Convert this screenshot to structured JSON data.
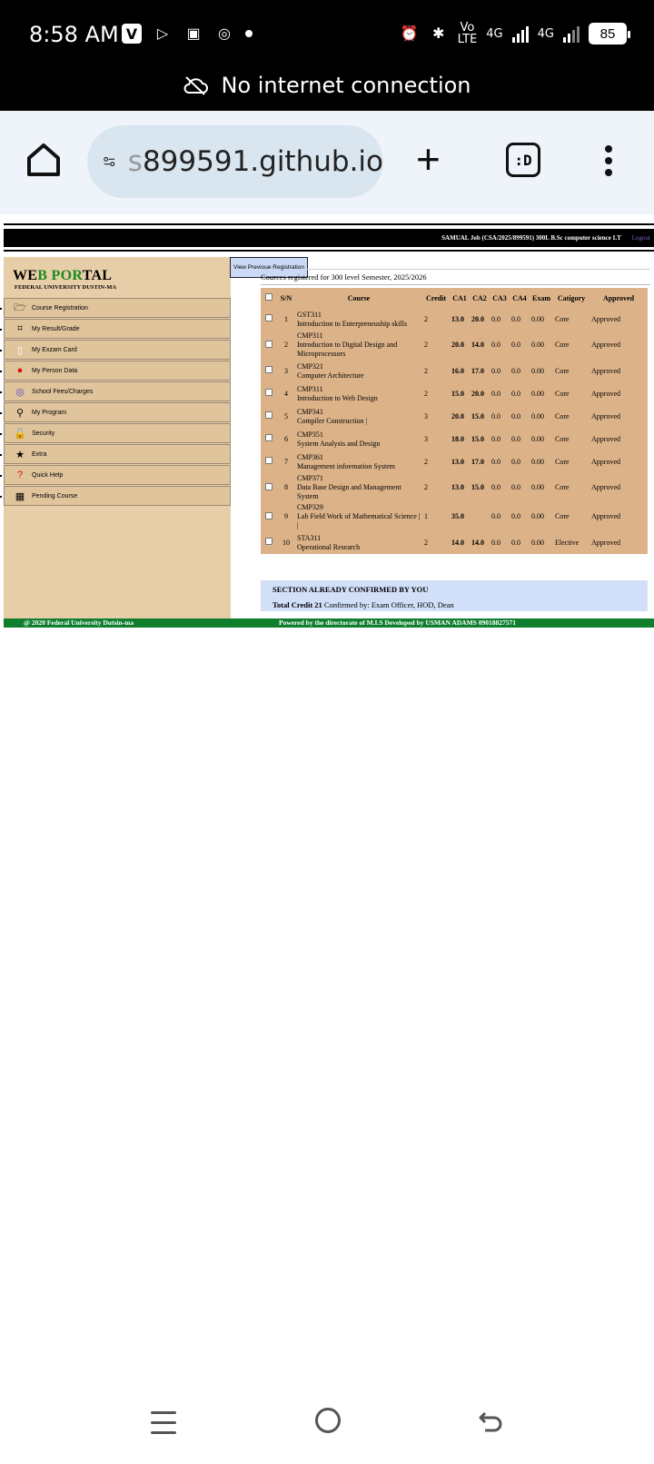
{
  "status_bar": {
    "time": "8:58 AM",
    "network_left": "Vo\nLTE",
    "net1": "4G",
    "net2": "4G",
    "battery": "85",
    "no_internet": "No internet connection"
  },
  "browser": {
    "url_fade": "s",
    "url": "899591.github.io",
    "tabs_label": ":D"
  },
  "header": {
    "user_info": "SAMUAL Job   (CSA/2025/899591)    300L B.Sc computer science I.T",
    "logout": "Logout"
  },
  "brand": {
    "part1": "WE",
    "part2": "B POR",
    "part3": "TAL",
    "subtitle": "FEDERAL UNIVERSITY DUSTIN-MA"
  },
  "menu": [
    {
      "label": "Course Registration",
      "icon": "folder-open-icon"
    },
    {
      "label": "My Result/Grade",
      "icon": "grid-icon"
    },
    {
      "label": "My Exzam Card",
      "icon": "file-icon"
    },
    {
      "label": "My Person Data",
      "icon": "user-icon"
    },
    {
      "label": "School Fees/Charges",
      "icon": "coins-icon"
    },
    {
      "label": "My Program",
      "icon": "search-icon"
    },
    {
      "label": "Security",
      "icon": "unlock-icon"
    },
    {
      "label": "Extra",
      "icon": "star-icon"
    },
    {
      "label": "Quick Help",
      "icon": "question-icon"
    },
    {
      "label": "Pending Course",
      "icon": "calendar-icon"
    }
  ],
  "view_previous_button": "View Previoue Registration",
  "courses_title": "Cources registered for 300 level Semester, 2025/2026",
  "table": {
    "headers": [
      "S/N",
      "Course",
      "Credit",
      "CA1",
      "CA2",
      "CA3",
      "CA4",
      "Exam",
      "Catigory",
      "Approved"
    ],
    "rows": [
      {
        "sn": "1",
        "code": "GST311",
        "title": "Introduction to Enterpreneuship skills",
        "credit": "2",
        "ca1": "13.0",
        "ca2": "20.0",
        "ca3": "0.0",
        "ca4": "0.0",
        "exam": "0.00",
        "category": "Core",
        "approved": "Approved"
      },
      {
        "sn": "2",
        "code": "CMP311",
        "title": "Introduction to Digital Design and Microprocessors",
        "credit": "2",
        "ca1": "20.0",
        "ca2": "14.0",
        "ca3": "0.0",
        "ca4": "0.0",
        "exam": "0.00",
        "category": "Core",
        "approved": "Approved"
      },
      {
        "sn": "3",
        "code": "CMP321",
        "title": "Computer Architecture",
        "credit": "2",
        "ca1": "16.0",
        "ca2": "17.0",
        "ca3": "0.0",
        "ca4": "0.0",
        "exam": "0.00",
        "category": "Core",
        "approved": "Approved"
      },
      {
        "sn": "4",
        "code": "CMP311",
        "title": "Introduction to Web Design",
        "credit": "2",
        "ca1": "15.0",
        "ca2": "20.0",
        "ca3": "0.0",
        "ca4": "0.0",
        "exam": "0.00",
        "category": "Core",
        "approved": "Approved"
      },
      {
        "sn": "5",
        "code": "CMP341",
        "title": "Compiler Construction  |",
        "credit": "3",
        "ca1": "20.0",
        "ca2": "15.0",
        "ca3": "0.0",
        "ca4": "0.0",
        "exam": "0.00",
        "category": "Core",
        "approved": "Approved"
      },
      {
        "sn": "6",
        "code": "CMP351",
        "title": "System Analysis and Design",
        "credit": "3",
        "ca1": "18.0",
        "ca2": "15.0",
        "ca3": "0.0",
        "ca4": "0.0",
        "exam": "0.00",
        "category": "Core",
        "approved": "Approved"
      },
      {
        "sn": "7",
        "code": "CMP361",
        "title": "Management infoemation System",
        "credit": "2",
        "ca1": "13.0",
        "ca2": "17.0",
        "ca3": "0.0",
        "ca4": "0.0",
        "exam": "0.00",
        "category": "Core",
        "approved": "Approved"
      },
      {
        "sn": "8",
        "code": "CMP371",
        "title": "Data Base Design and Management System",
        "credit": "2",
        "ca1": "13.0",
        "ca2": "15.0",
        "ca3": "0.0",
        "ca4": "0.0",
        "exam": "0.00",
        "category": "Core",
        "approved": "Approved"
      },
      {
        "sn": "9",
        "code": "CMP329",
        "title": "Lab Field Work of Mathematical Science | |",
        "credit": "1",
        "ca1": "35.0",
        "ca2": "",
        "ca3": "0.0",
        "ca4": "0.0",
        "exam": "0.00",
        "category": "Core",
        "approved": "Approved"
      },
      {
        "sn": "10",
        "code": "STA311",
        "title": "Operational Research",
        "credit": "2",
        "ca1": "14.0",
        "ca2": "14.0",
        "ca3": "0.0",
        "ca4": "0.0",
        "exam": "0.00",
        "category": "Elective",
        "approved": "Approved"
      }
    ]
  },
  "confirmation": {
    "section_text": "SECTION ALREADY CONFIRMED BY YOU",
    "total_label": "Total Credit 21",
    "confirmed_by": " Confirmed by: Exam Officer, HOD, Dean"
  },
  "footer": {
    "left": "@ 2020 Federal University Dutsin-ma",
    "right": "Powered by the directorate of   M.I.S   Developed    by     USMAN ADAMS   09018827571"
  },
  "colors": {
    "sidebar": "#e8cea8",
    "table": "#dcb389",
    "confirm": "#d1dff8",
    "footer": "#0f7f2e",
    "brand_green": "#1d8a1d"
  }
}
